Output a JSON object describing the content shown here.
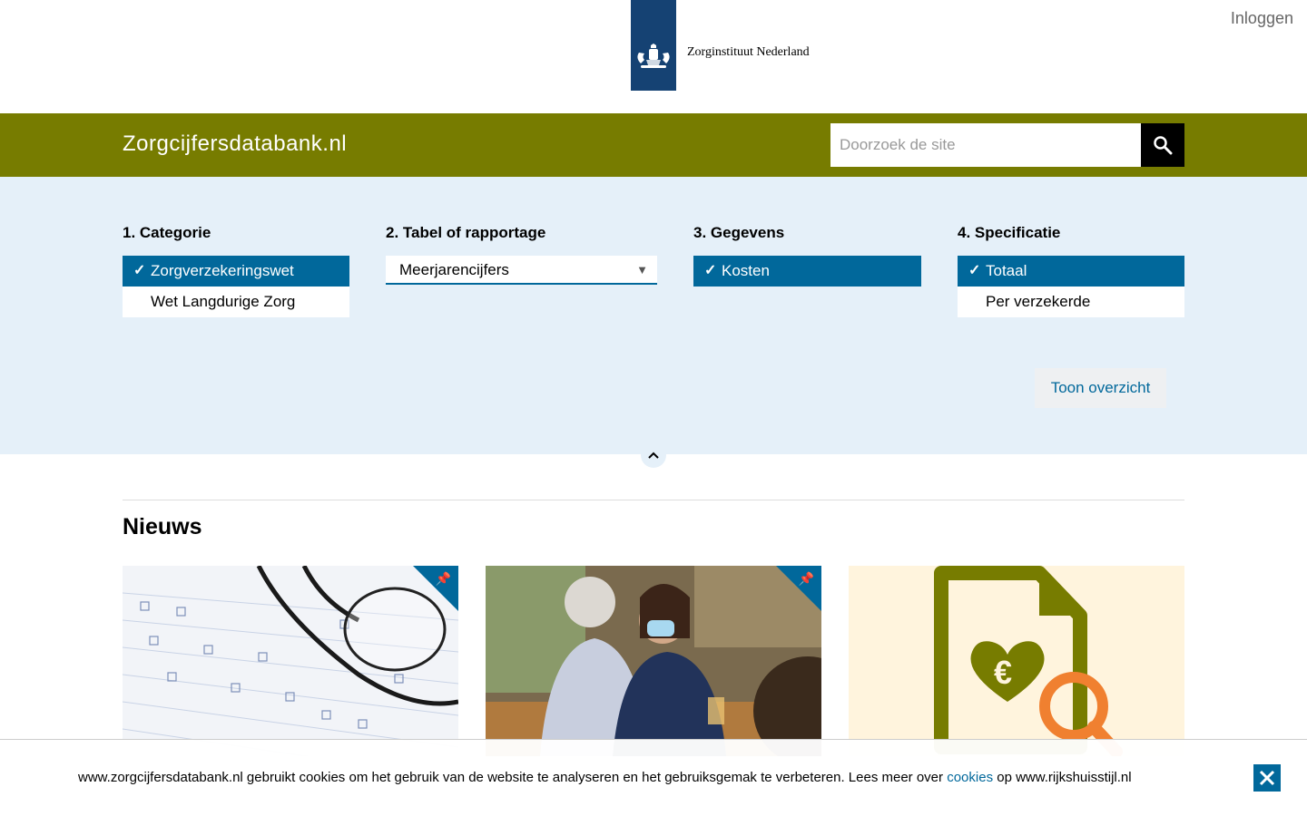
{
  "header": {
    "org_name": "Zorginstituut Nederland",
    "login": "Inloggen"
  },
  "brandbar": {
    "site_title": "Zorgcijfersdatabank.nl",
    "search_placeholder": "Doorzoek de site",
    "bg_color": "#777c00"
  },
  "selector": {
    "categorie": {
      "heading": "1. Categorie",
      "options": [
        {
          "label": "Zorgverzekeringswet",
          "selected": true
        },
        {
          "label": "Wet Langdurige Zorg",
          "selected": false
        }
      ]
    },
    "tabel": {
      "heading": "2. Tabel of rapportage",
      "value": "Meerjarencijfers"
    },
    "gegevens": {
      "heading": "3. Gegevens",
      "options": [
        {
          "label": "Kosten",
          "selected": true
        }
      ]
    },
    "specificatie": {
      "heading": "4. Specificatie",
      "options": [
        {
          "label": "Totaal",
          "selected": true
        },
        {
          "label": "Per verzekerde",
          "selected": false
        }
      ]
    },
    "submit": "Toon overzicht"
  },
  "news": {
    "title": "Nieuws",
    "cards": [
      {
        "image": "glasses-on-survey-form",
        "pinned": true
      },
      {
        "image": "nurse-with-elderly-woman",
        "pinned": true
      },
      {
        "image": "document-euro-search-icon",
        "pinned": false
      }
    ]
  },
  "cookie": {
    "text_before": "www.zorgcijfersdatabank.nl gebruikt cookies om het gebruik van de website te analyseren en het gebruiksgemak te verbeteren. Lees meer over",
    "link": "cookies",
    "text_after": "op www.rijkshuisstijl.nl"
  },
  "colors": {
    "primary_blue": "#01689b",
    "logo_blue": "#154273",
    "panel_bg": "#e5f0f9"
  }
}
